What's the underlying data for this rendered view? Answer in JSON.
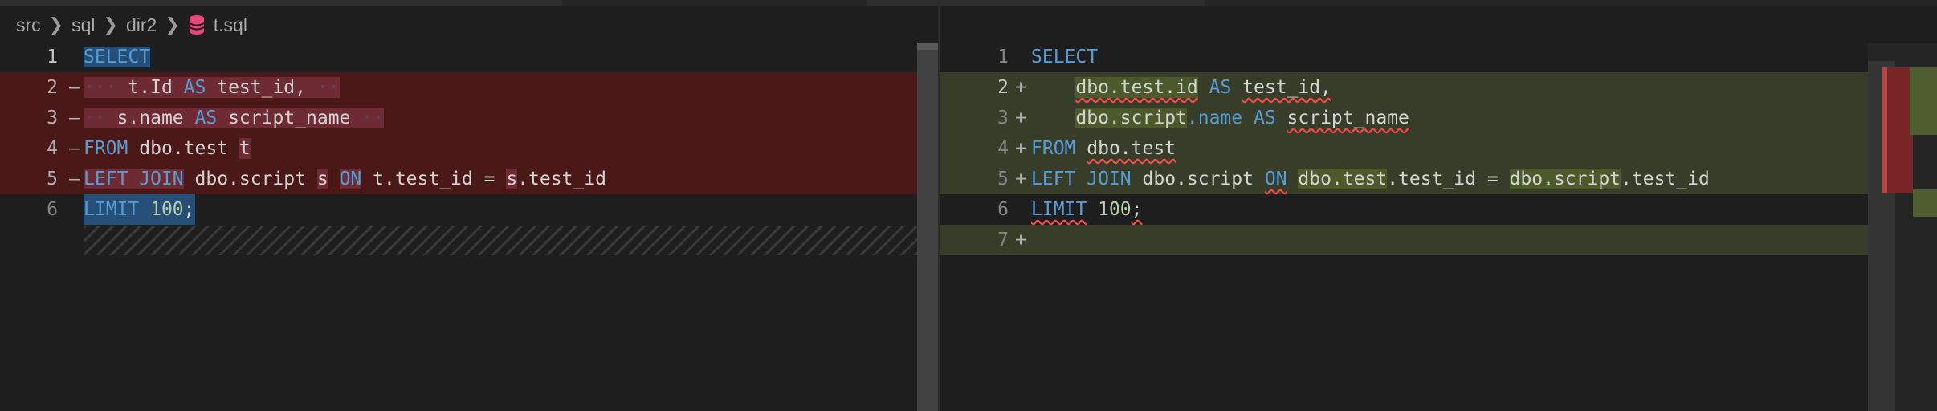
{
  "breadcrumb": {
    "items": [
      "src",
      "sql",
      "dir2",
      "t.sql"
    ],
    "file_icon": "database-icon",
    "separator_icon": "chevron-right-icon"
  },
  "colors": {
    "removed_line": "#4b1818",
    "added_line": "#373d29",
    "keyword": "#569cd6",
    "number": "#b5cea8"
  },
  "left": {
    "lines": [
      {
        "num": "1",
        "marker": ""
      },
      {
        "num": "2",
        "marker": "—"
      },
      {
        "num": "3",
        "marker": "—"
      },
      {
        "num": "4",
        "marker": "—"
      },
      {
        "num": "5",
        "marker": "—"
      },
      {
        "num": "6",
        "marker": ""
      }
    ],
    "tokens": {
      "l1_select": "SELECT",
      "l2_t": "t.Id",
      "l2_as": "AS",
      "l2_alias": "test_id,",
      "l3_s": "s.name",
      "l3_as": "AS",
      "l3_alias": "script_name",
      "l4_from": "FROM",
      "l4_table": "dbo.test",
      "l4_alias": "t",
      "l5_left": "LEFT",
      "l5_join": "JOIN",
      "l5_table": "dbo.script",
      "l5_alias": "s",
      "l5_on": "ON",
      "l5_c1": "t.test_id",
      "l5_eq": "=",
      "l5_c2": "s",
      "l5_c2b": ".test_id",
      "l6_limit": "LIMIT",
      "l6_num": "100",
      "l6_semi": ";"
    }
  },
  "right": {
    "lines": [
      {
        "num": "1",
        "marker": ""
      },
      {
        "num": "2",
        "marker": "+"
      },
      {
        "num": "3",
        "marker": "+"
      },
      {
        "num": "4",
        "marker": "+"
      },
      {
        "num": "5",
        "marker": "+"
      },
      {
        "num": "6",
        "marker": ""
      },
      {
        "num": "7",
        "marker": "+"
      }
    ],
    "tokens": {
      "l1_select": "SELECT",
      "l2_col": "dbo.test.id",
      "l2_as": "AS",
      "l2_alias": "test_id,",
      "l3_col_a": "dbo.script",
      "l3_col_b": ".name",
      "l3_as": "AS",
      "l3_alias": "script_name",
      "l4_from": "FROM",
      "l4_table": "dbo.test",
      "l5_left": "LEFT",
      "l5_join": "JOIN",
      "l5_table": "dbo.script",
      "l5_on": "ON",
      "l5_c1": "dbo.test",
      "l5_c1b": ".test_id",
      "l5_eq": "=",
      "l5_c2": "dbo.script",
      "l5_c2b": ".test_id",
      "l6_limit": "LIMIT",
      "l6_num": "100",
      "l6_semi": ";"
    }
  }
}
